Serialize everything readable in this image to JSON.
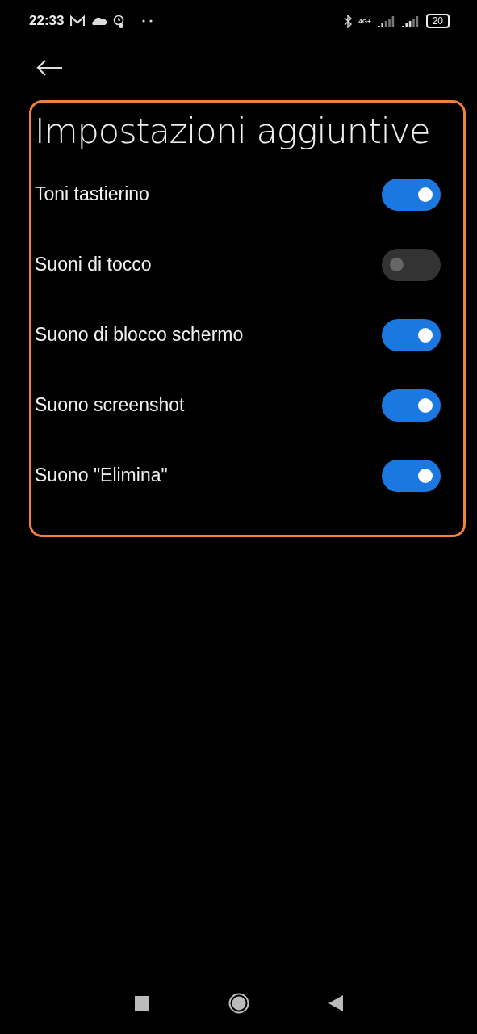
{
  "status_bar": {
    "time": "22:33",
    "network": "4G+",
    "battery": "20"
  },
  "section": {
    "title": "Impostazioni aggiuntive",
    "highlighted": true,
    "settings": [
      {
        "label": "Toni tastierino",
        "on": true
      },
      {
        "label": "Suoni di tocco",
        "on": false
      },
      {
        "label": "Suono di blocco schermo",
        "on": true
      },
      {
        "label": "Suono screenshot",
        "on": true
      },
      {
        "label": "Suono \"Elimina\"",
        "on": true
      }
    ]
  }
}
